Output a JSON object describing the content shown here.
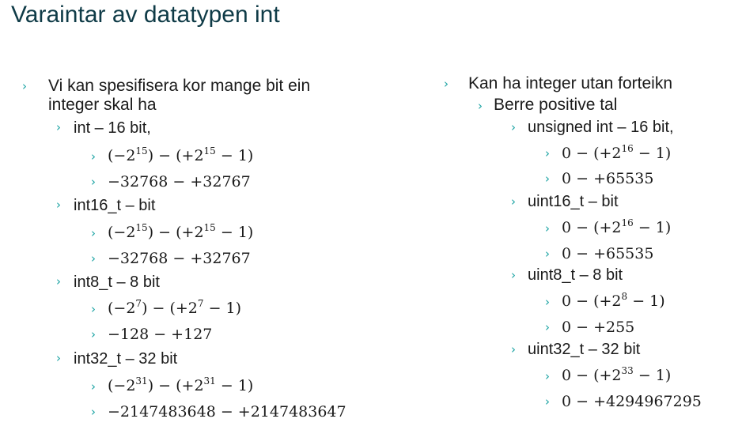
{
  "title": "Varaintar av datatypen int",
  "left": {
    "intro": [
      "Vi kan spesifisera kor mange bit ein",
      "integer skal ha"
    ],
    "groups": [
      {
        "label": "int – 16 bit,",
        "range_expr": {
          "lo": "(−2",
          "lo_exp": "15",
          "mid": ") − (+2",
          "hi_exp": "15",
          "end": " − 1)"
        },
        "range_num": "−32768 − +32767"
      },
      {
        "label": "int16_t – bit",
        "range_expr": {
          "lo": "(−2",
          "lo_exp": "15",
          "mid": ") − (+2",
          "hi_exp": "15",
          "end": " − 1)"
        },
        "range_num": "−32768 − +32767"
      },
      {
        "label": "int8_t – 8 bit",
        "range_expr": {
          "lo": "(−2",
          "lo_exp": "7",
          "mid": ") − (+2",
          "hi_exp": "7",
          "end": " − 1)"
        },
        "range_num": "−128 − +127"
      },
      {
        "label": "int32_t – 32 bit",
        "range_expr": {
          "lo": "(−2",
          "lo_exp": "31",
          "mid": ") − (+2",
          "hi_exp": "31",
          "end": " − 1)"
        },
        "range_num": "−2147483648 − +2147483647"
      }
    ]
  },
  "right": {
    "intro": "Kan ha integer utan forteikn",
    "sub": "Berre positive tal",
    "groups": [
      {
        "label": "unsigned int – 16 bit,",
        "range_expr": {
          "pre": "0 − (+2",
          "exp": "16",
          "end": " − 1)"
        },
        "range_num": "0 − +65535"
      },
      {
        "label": "uint16_t – bit",
        "range_expr": {
          "pre": "0 − (+2",
          "exp": "16",
          "end": " − 1)"
        },
        "range_num": "0 − +65535"
      },
      {
        "label": "uint8_t – 8 bit",
        "range_expr": {
          "pre": "0 − (+2",
          "exp": "8",
          "end": " − 1)"
        },
        "range_num": "0 − +255"
      },
      {
        "label": "uint32_t – 32 bit",
        "range_expr": {
          "pre": "0 − (+2",
          "exp": "33",
          "end": " − 1)"
        },
        "range_num": "0 − +4294967295"
      }
    ]
  },
  "bullet_glyph": "›",
  "colors": {
    "title": "#0f3b47",
    "bullet": "#1aa3a3",
    "text": "#1a1a1a"
  }
}
